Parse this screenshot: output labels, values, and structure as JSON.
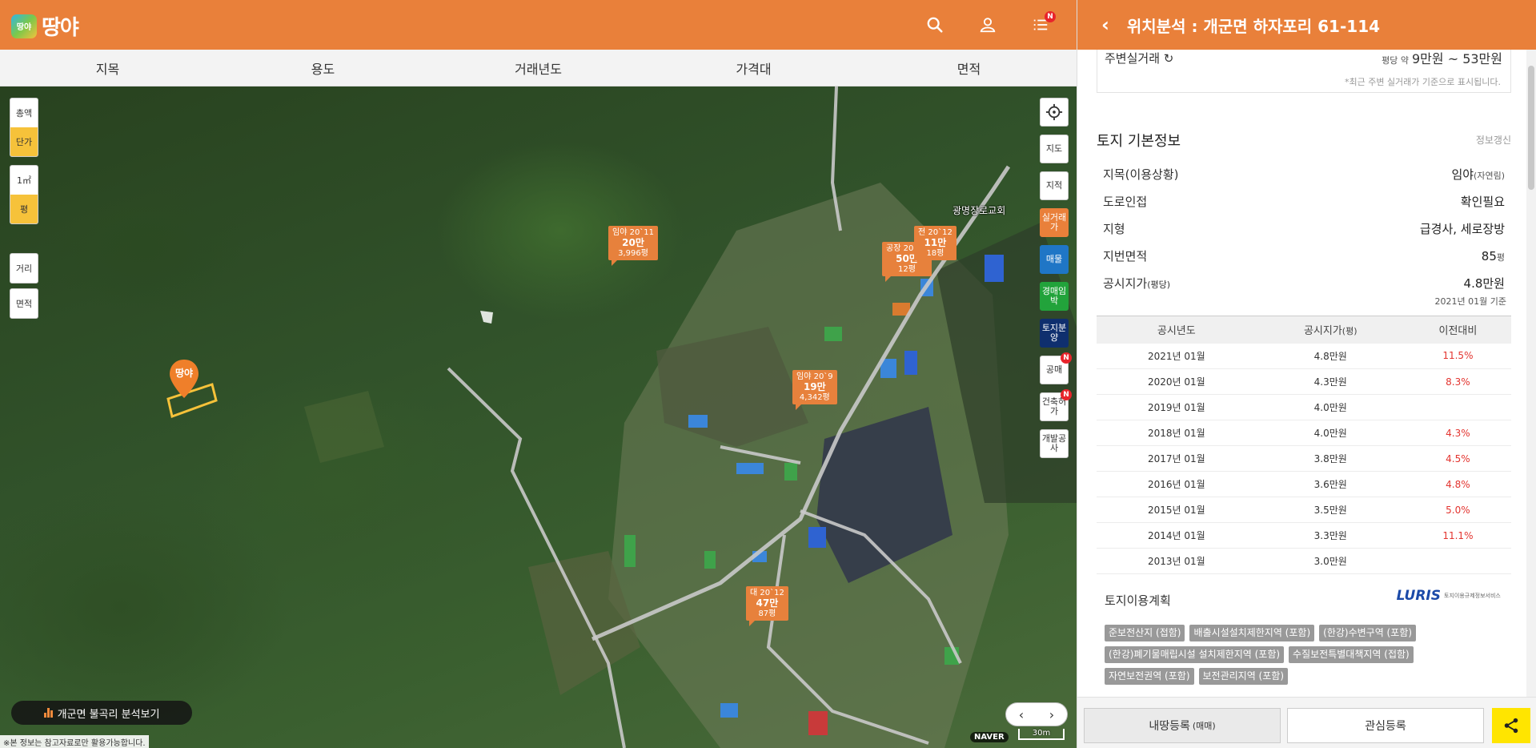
{
  "header": {
    "logo_badge": "땅야",
    "logo_text": "땅야",
    "icons": [
      "search-icon",
      "user-icon",
      "list-icon"
    ],
    "notification_badge": "N"
  },
  "filters": [
    "지목",
    "용도",
    "거래년도",
    "가격대",
    "면적"
  ],
  "map": {
    "left_controls": {
      "total": "총액",
      "unit": "단가",
      "sqm": "1㎡",
      "pyeong": "평",
      "distance": "거리",
      "area": "면적"
    },
    "right_controls": {
      "locate_icon": "crosshair-icon",
      "map": "지도",
      "cadastral": "지적",
      "real_trade": "실거래가",
      "sale": "매물",
      "auction": "경매임박",
      "land_sale": "토지분양",
      "public_sale": "공매",
      "permit": "건축허가",
      "dev_work": "개발공사",
      "badge": "N"
    },
    "price_tags": [
      {
        "line1": "임야 20`11",
        "price": "20만",
        "area": "3,996평"
      },
      {
        "line1": "공장 20`12",
        "price": "50만",
        "area": "12평"
      },
      {
        "line1": "전 20`12",
        "price": "11만",
        "area": "18평"
      },
      {
        "line1": "임야 20`9",
        "price": "19만",
        "area": "4,342평"
      },
      {
        "line1": "대 20`12",
        "price": "47만",
        "area": "87평"
      }
    ],
    "pin_label": "땅야",
    "poi_church": "광명장로교회",
    "analysis_button": "개군면 불곡리 분석보기",
    "disclaimer": "※본 정보는 참고자료로만 활용가능합니다.",
    "pager_prev": "‹",
    "pager_next": "›",
    "naver": "NAVER",
    "scale": "30m"
  },
  "panel": {
    "back": "‹",
    "title": "위치분석 : 개군면 하자포리 61-114",
    "nearby": {
      "title": "주변실거래 ↻",
      "price_prefix": "평당 약",
      "price": "9만원 ~ 53만원",
      "note": "*최근 주변 실거래가 기준으로 표시됩니다."
    },
    "basic_info": {
      "title": "토지 기본정보",
      "refresh": "정보갱신",
      "rows": [
        {
          "label": "지목(이용상황)",
          "value": "임야",
          "value_sub": "(자연림)"
        },
        {
          "label": "도로인접",
          "value": "확인필요"
        },
        {
          "label": "지형",
          "value": "급경사, 세로장방"
        },
        {
          "label": "지번면적",
          "value": "85",
          "value_sub": "평"
        },
        {
          "label": "공시지가",
          "label_sub": "(평당)",
          "value": "4.8만원"
        }
      ],
      "basis_note": "2021년 01월 기준"
    },
    "table": {
      "headers": [
        "공시년도",
        "공시지가",
        "이전대비"
      ],
      "header_sub": "(평)",
      "rows": [
        {
          "year": "2021년 01월",
          "price": "4.8만원",
          "change": "11.5%"
        },
        {
          "year": "2020년 01월",
          "price": "4.3만원",
          "change": "8.3%"
        },
        {
          "year": "2019년 01월",
          "price": "4.0만원",
          "change": ""
        },
        {
          "year": "2018년 01월",
          "price": "4.0만원",
          "change": "4.3%"
        },
        {
          "year": "2017년 01월",
          "price": "3.8만원",
          "change": "4.5%"
        },
        {
          "year": "2016년 01월",
          "price": "3.6만원",
          "change": "4.8%"
        },
        {
          "year": "2015년 01월",
          "price": "3.5만원",
          "change": "5.0%"
        },
        {
          "year": "2014년 01월",
          "price": "3.3만원",
          "change": "11.1%"
        },
        {
          "year": "2013년 01월",
          "price": "3.0만원",
          "change": ""
        }
      ]
    },
    "land_plan": {
      "title": "토지이용계획",
      "luris_mark": "LURIS",
      "luris_text": "토지이용규제정보서비스",
      "chips": [
        "준보전산지 (접함)",
        "배출시설설치제한지역 (포함)",
        "(한강)수변구역 (포함)",
        "(한강)폐기물매립시설 설치제한지역 (포함)",
        "수질보전특별대책지역 (접함)",
        "자연보전권역 (포함)",
        "보전관리지역 (포함)"
      ]
    },
    "footer": {
      "register": "내땅등록",
      "register_sub": "(매매)",
      "interest": "관심등록",
      "share_icon": "share-icon"
    }
  }
}
